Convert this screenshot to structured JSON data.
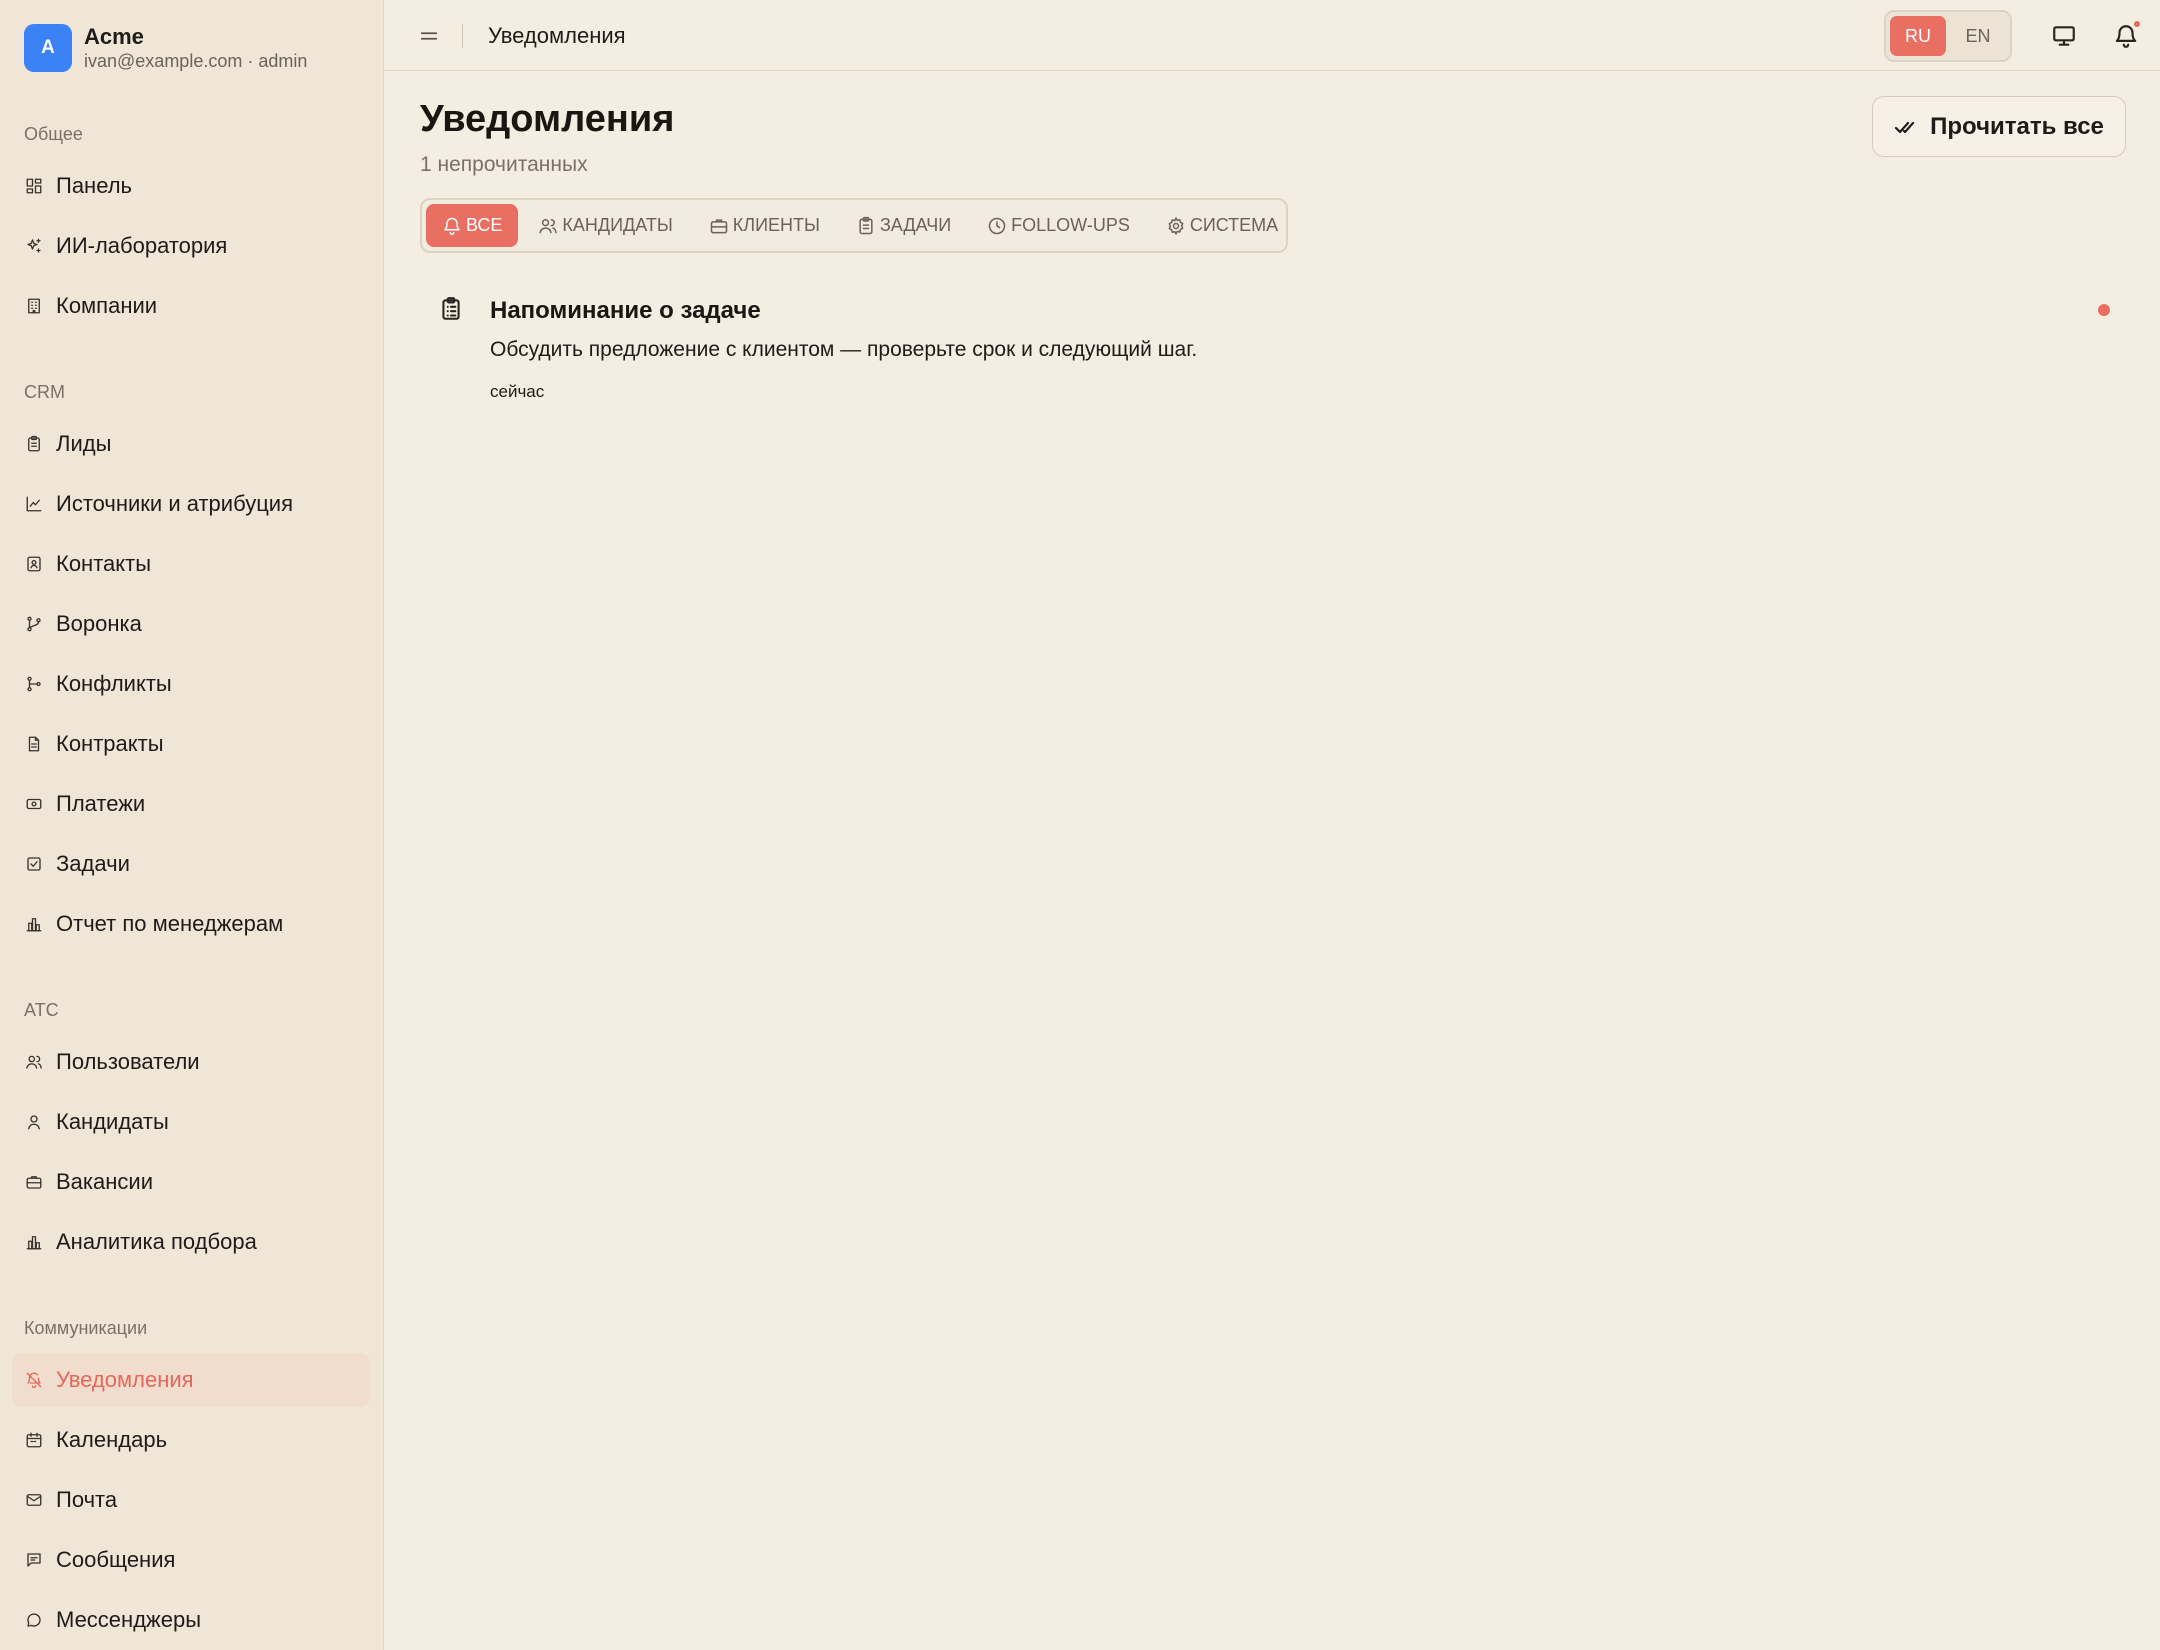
{
  "profile": {
    "avatar_letter": "A",
    "org_name": "Acme",
    "user_line": "ivan@example.com · admin"
  },
  "sidebar": {
    "sections": [
      {
        "title": "Общее",
        "items": [
          {
            "label": "Панель",
            "icon": "dashboard-icon"
          },
          {
            "label": "ИИ-лаборатория",
            "icon": "sparkles-icon"
          },
          {
            "label": "Компании",
            "icon": "building-icon"
          }
        ]
      },
      {
        "title": "CRM",
        "items": [
          {
            "label": "Лиды",
            "icon": "clipboard-icon"
          },
          {
            "label": "Источники и атрибуция",
            "icon": "line-chart-icon"
          },
          {
            "label": "Контакты",
            "icon": "contact-book-icon"
          },
          {
            "label": "Воронка",
            "icon": "git-branch-icon"
          },
          {
            "label": "Конфликты",
            "icon": "git-fork-icon"
          },
          {
            "label": "Контракты",
            "icon": "document-icon"
          },
          {
            "label": "Платежи",
            "icon": "banknote-icon"
          },
          {
            "label": "Задачи",
            "icon": "checkbox-icon"
          },
          {
            "label": "Отчет по менеджерам",
            "icon": "bar-chart-icon"
          }
        ]
      },
      {
        "title": "ATC",
        "items": [
          {
            "label": "Пользователи",
            "icon": "users-icon"
          },
          {
            "label": "Кандидаты",
            "icon": "user-icon"
          },
          {
            "label": "Вакансии",
            "icon": "briefcase-icon"
          },
          {
            "label": "Аналитика подбора",
            "icon": "bar-chart-icon"
          }
        ]
      },
      {
        "title": "Коммуникации",
        "items": [
          {
            "label": "Уведомления",
            "icon": "bell-off-icon",
            "active": true
          },
          {
            "label": "Календарь",
            "icon": "calendar-icon"
          },
          {
            "label": "Почта",
            "icon": "mail-icon"
          },
          {
            "label": "Сообщения",
            "icon": "message-square-icon"
          },
          {
            "label": "Мессенджеры",
            "icon": "message-circle-icon"
          }
        ]
      }
    ]
  },
  "topbar": {
    "title": "Уведомления",
    "languages": [
      {
        "code": "RU",
        "active": true
      },
      {
        "code": "EN",
        "active": false
      }
    ]
  },
  "page": {
    "title": "Уведомления",
    "subtitle": "1 непрочитанных",
    "read_all_label": "Прочитать все"
  },
  "tabs": [
    {
      "label": "ВСЕ",
      "icon": "bell-icon",
      "active": true
    },
    {
      "label": "КАНДИДАТЫ",
      "icon": "users-icon"
    },
    {
      "label": "КЛИЕНТЫ",
      "icon": "briefcase-icon"
    },
    {
      "label": "ЗАДАЧИ",
      "icon": "clipboard-icon"
    },
    {
      "label": "FOLLOW-UPS",
      "icon": "clock-icon"
    },
    {
      "label": "СИСТЕМА",
      "icon": "gear-icon"
    }
  ],
  "notifications": [
    {
      "icon": "clipboard-list-icon",
      "title": "Напоминание о задаче",
      "body": "Обсудить предложение с клиентом — проверьте срок и следующий шаг.",
      "time": "сейчас",
      "unread": true
    }
  ],
  "colors": {
    "accent": "#ea6f63",
    "background": "#f4ede1",
    "sidebar": "#efe6d8",
    "avatar": "#3b82f6"
  }
}
